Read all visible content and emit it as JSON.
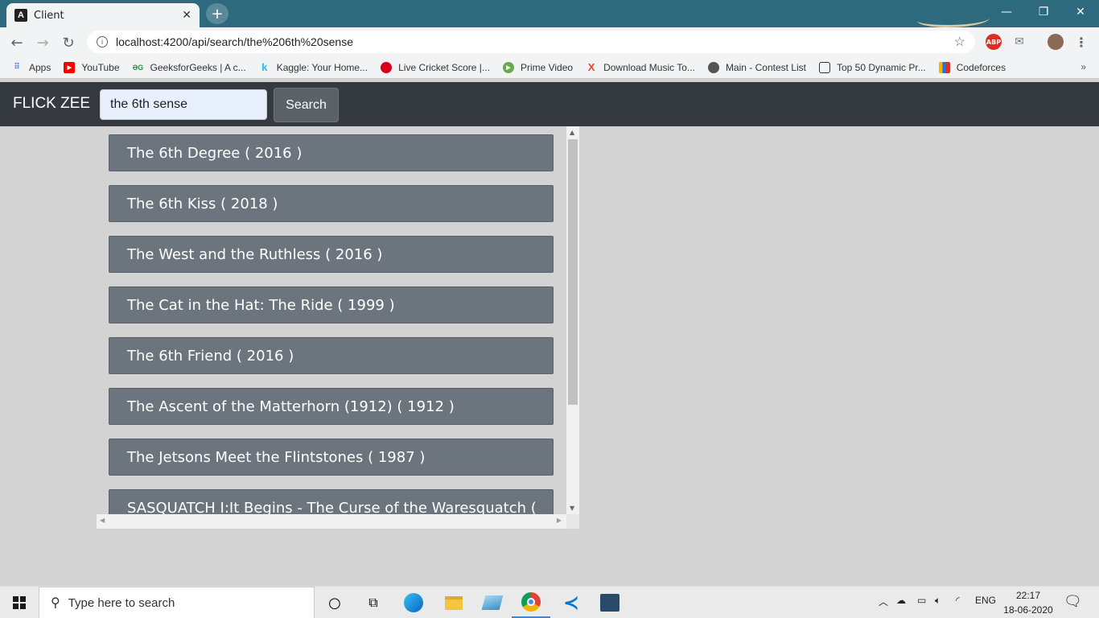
{
  "browser": {
    "tab_title": "Client",
    "tab_close": "✕",
    "new_tab": "+",
    "url": "localhost:4200/api/search/the%206th%20sense",
    "window_controls": {
      "minimize": "—",
      "restore": "❐",
      "close": "✕"
    }
  },
  "bookmarks": [
    {
      "label": "Apps",
      "icon": "apps-grid-icon",
      "color": "#4285f4"
    },
    {
      "label": "YouTube",
      "icon": "youtube-icon",
      "color": "#ff0000"
    },
    {
      "label": "GeeksforGeeks | A c...",
      "icon": "geeksforgeeks-icon",
      "color": "#2f8d46"
    },
    {
      "label": "Kaggle: Your Home...",
      "icon": "kaggle-icon",
      "color": "#20beff"
    },
    {
      "label": "Live Cricket Score |...",
      "icon": "cricket-icon",
      "color": "#d6001c"
    },
    {
      "label": "Prime Video",
      "icon": "prime-video-icon",
      "color": "#6aa84f"
    },
    {
      "label": "Download Music To...",
      "icon": "music-x-icon",
      "color": "#e8452c"
    },
    {
      "label": "Main - Contest List",
      "icon": "contest-icon",
      "color": "#555555"
    },
    {
      "label": "Top 50 Dynamic Pr...",
      "icon": "page-icon",
      "color": "#333333"
    },
    {
      "label": "Codeforces",
      "icon": "codeforces-icon",
      "color": "#f4b400"
    }
  ],
  "bookmarks_more": "»",
  "app": {
    "brand": "FLICK ZEE",
    "search_value": "the 6th sense",
    "search_button": "Search"
  },
  "results": [
    "The 6th Degree ( 2016 )",
    "The 6th Kiss ( 2018 )",
    "The West and the Ruthless ( 2016 )",
    "The Cat in the Hat: The Ride ( 1999 )",
    "The 6th Friend ( 2016 )",
    "The Ascent of the Matterhorn (1912) ( 1912 )",
    "The Jetsons Meet the Flintstones ( 1987 )",
    "SASQUATCH I:It Begins - The Curse of the Waresquatch ("
  ],
  "taskbar": {
    "search_placeholder": "Type here to search",
    "language": "ENG",
    "time": "22:17",
    "date": "18-06-2020"
  },
  "colors": {
    "navbar": "#343a40",
    "card": "#6c757d",
    "page_bg": "#d3d3d3",
    "titlebar": "#2d6a7e"
  }
}
